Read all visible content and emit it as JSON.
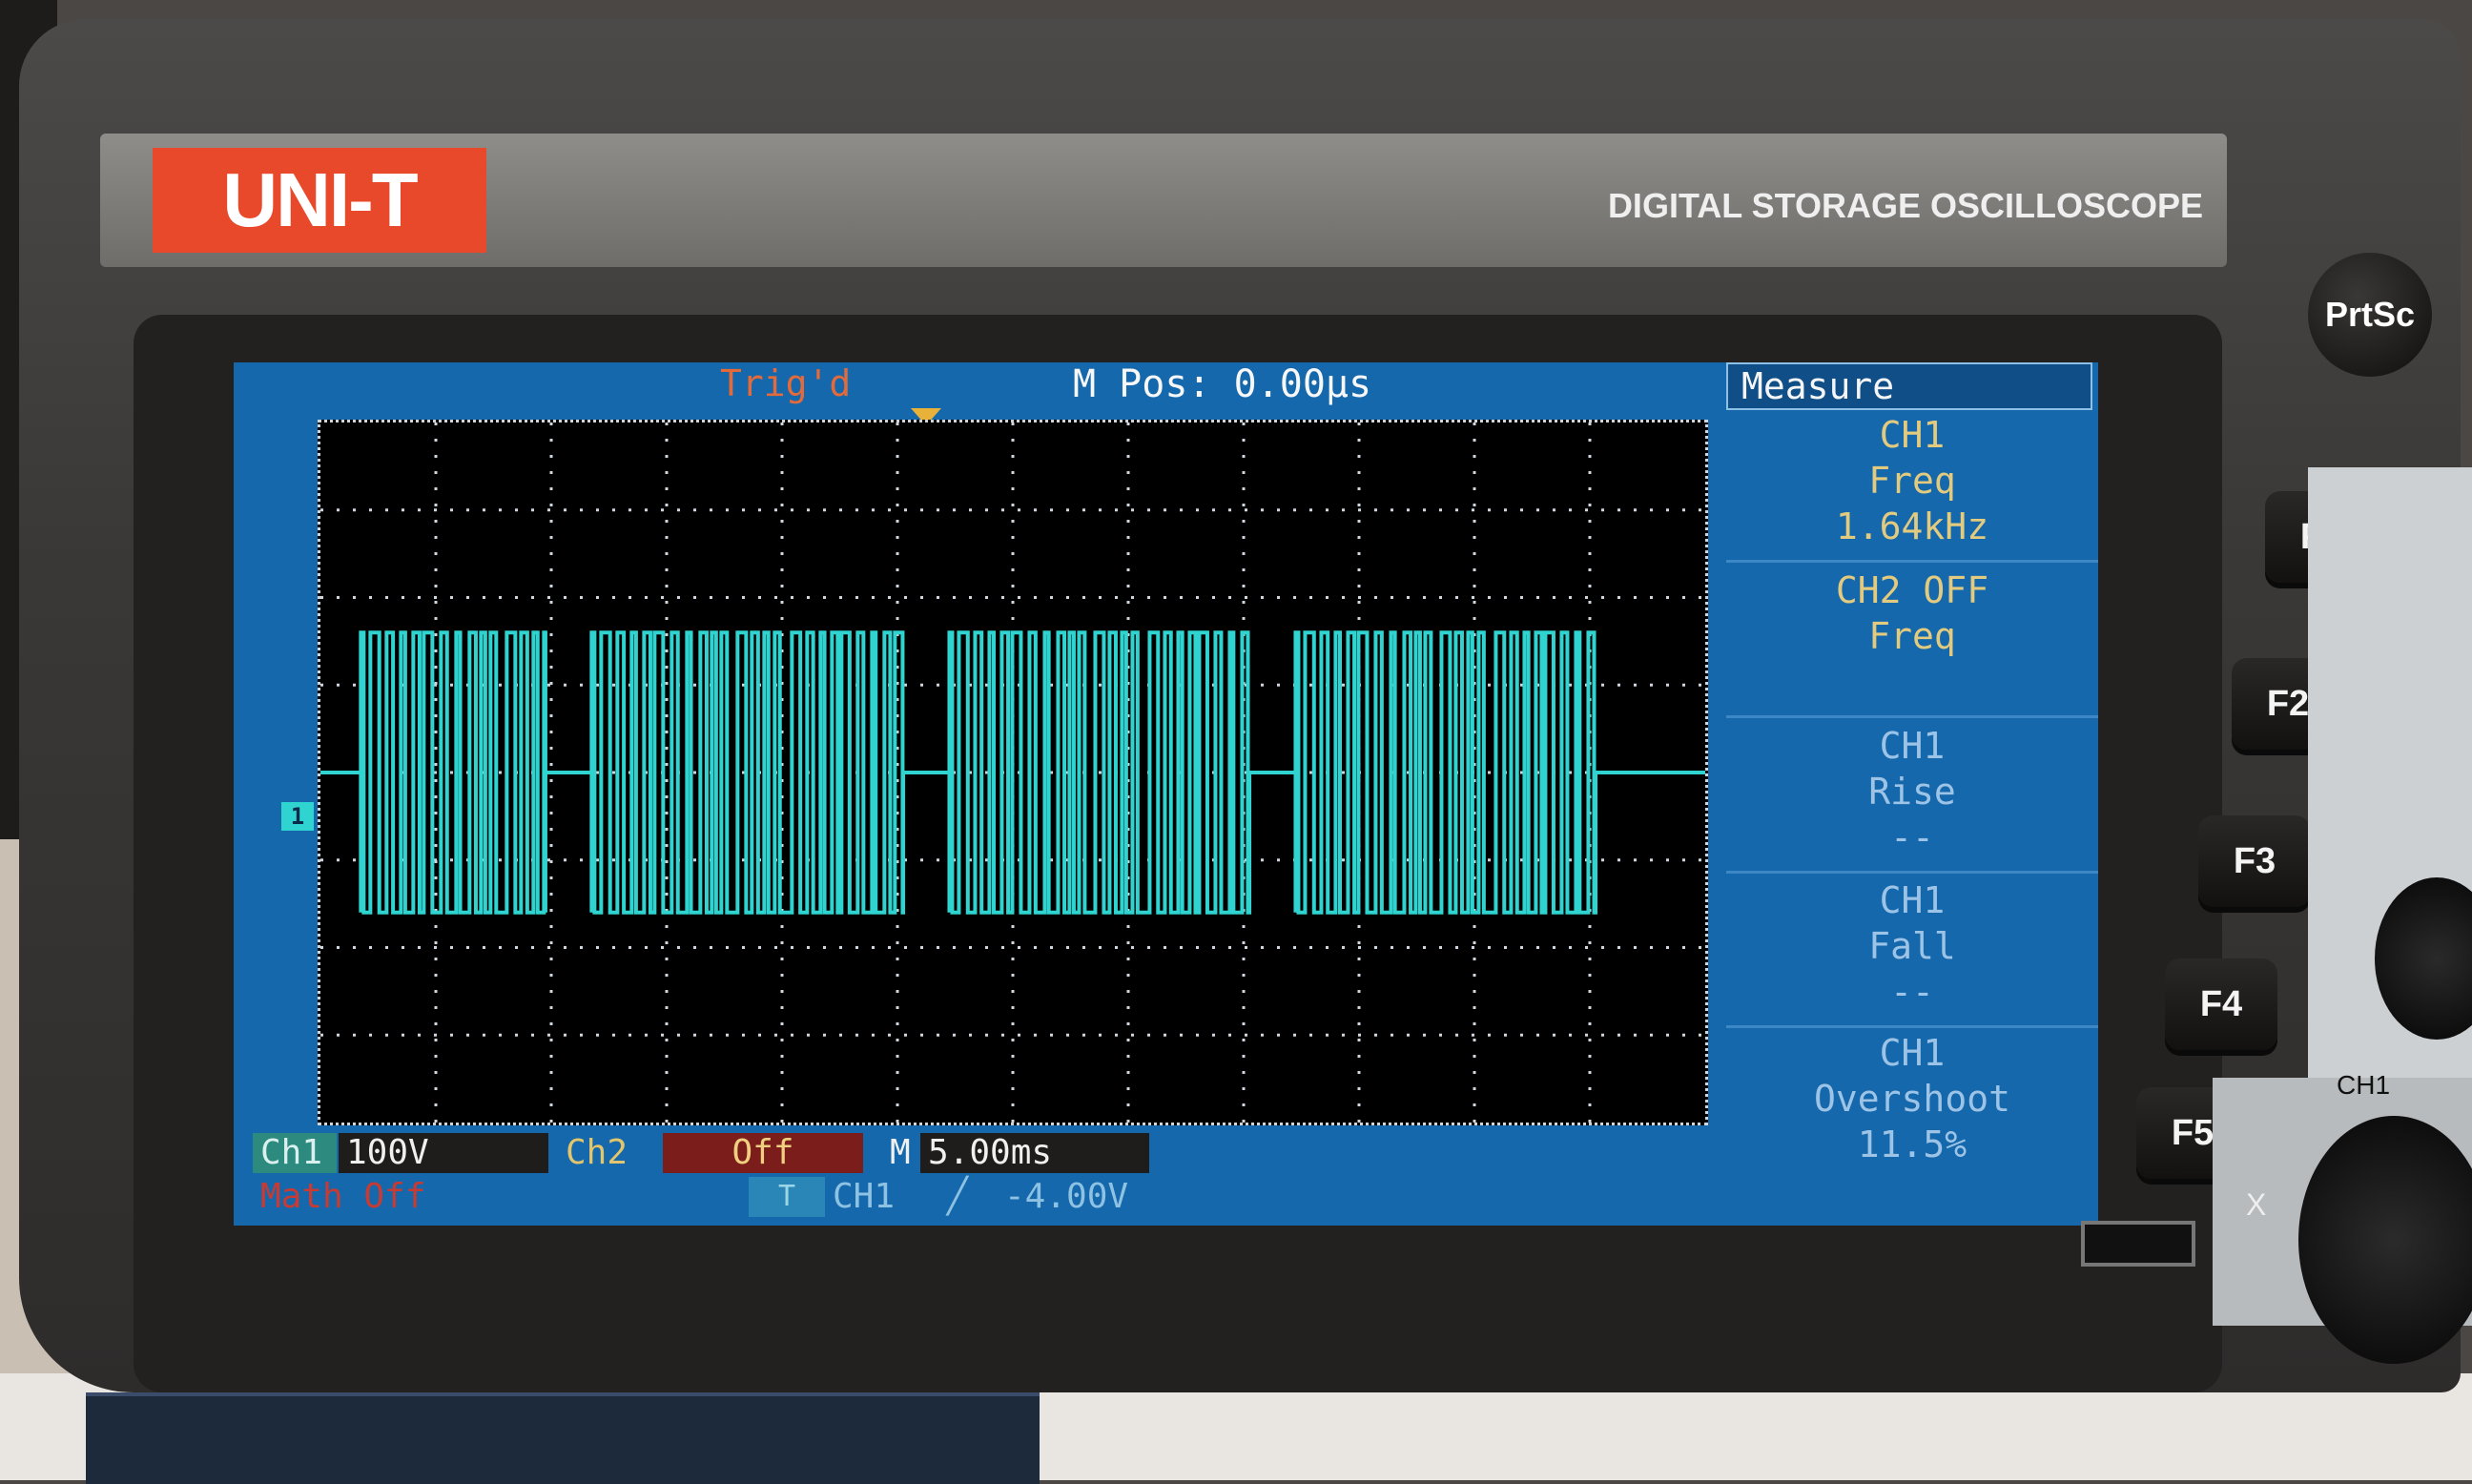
{
  "device": {
    "brand": "UNI-T",
    "product_title": "DIGITAL STORAGE OSCILLOSCOPE"
  },
  "screen": {
    "trigger_status": "Trig'd",
    "horizontal_position": "M Pos: 0.00µs",
    "channel_marker": "1",
    "waveform": {
      "color": "#2fd3cf",
      "description_bursts": 4,
      "bursts": [
        {
          "start_div": 0.35,
          "end_div": 1.95
        },
        {
          "start_div": 2.35,
          "end_div": 5.05
        },
        {
          "start_div": 5.45,
          "end_div": 8.05
        },
        {
          "start_div": 8.45,
          "end_div": 11.05
        }
      ],
      "high_div": 1.6,
      "low_div": -1.6,
      "idle_div": 0.0
    },
    "menu": {
      "title": "Measure",
      "slots": [
        {
          "line1": "CH1",
          "line2": "Freq",
          "line3": "1.64kHz"
        },
        {
          "line1": "CH2  OFF",
          "line2": "Freq",
          "line3": ""
        },
        {
          "line1": "CH1",
          "line2": "Rise",
          "line3": "--"
        },
        {
          "line1": "CH1",
          "line2": "Fall",
          "line3": "--"
        },
        {
          "line1": "CH1",
          "line2": "Overshoot",
          "line3": "11.5%"
        }
      ]
    },
    "status": {
      "ch1_label": "Ch1",
      "ch1_scale": "100V",
      "ch2_label": "Ch2",
      "ch2_scale": "Off",
      "time_label": "M",
      "time_scale": "5.00ms",
      "math_label": "Math Off",
      "trigger_source_icon": "T",
      "trigger_channel": "CH1",
      "trigger_slope": "╱",
      "trigger_level": "-4.00V"
    }
  },
  "controls": {
    "prtsc_label": "PrtSc",
    "function_keys": [
      "F1",
      "F2",
      "F3",
      "F4",
      "F5"
    ],
    "ch1_label": "CH1",
    "x_label": "X"
  },
  "colors": {
    "lcd_background": "#1568ac",
    "trace": "#2fd3cf",
    "brand_red": "#e8492b"
  }
}
